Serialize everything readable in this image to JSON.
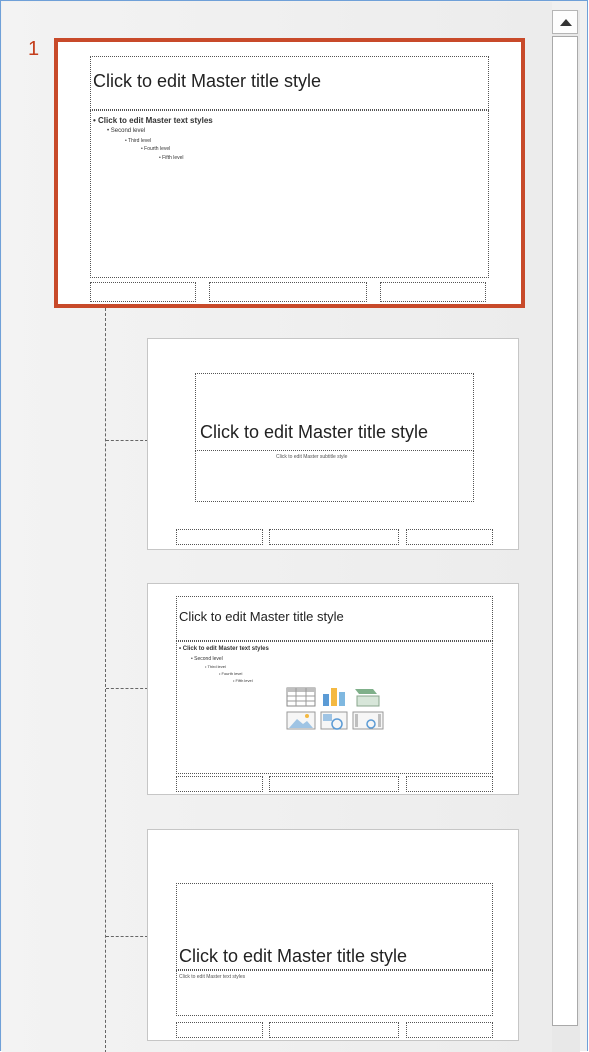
{
  "slide_panel": {
    "master": {
      "number": "1",
      "title": "Click to edit Master title style",
      "levels": [
        "• Click to edit Master text styles",
        "• Second level",
        "• Third level",
        "• Fourth level",
        "• Fifth level"
      ]
    },
    "layouts": [
      {
        "name": "title-slide-layout",
        "title": "Click to edit Master title style",
        "subtitle": "Click to edit Master subtitle style"
      },
      {
        "name": "title-and-content-layout",
        "title": "Click to edit Master title style",
        "levels": [
          "• Click to edit Master text styles",
          "• Second level",
          "• Third level",
          "• Fourth level",
          "• Fifth level"
        ],
        "content_icons": [
          "table-icon",
          "chart-icon",
          "smartart-icon",
          "picture-icon",
          "online-picture-icon",
          "video-icon"
        ]
      },
      {
        "name": "section-header-layout",
        "title": "Click to edit Master title style",
        "text": "Click to edit Master text styles"
      }
    ]
  },
  "scrollbar": {
    "up_icon": "arrow-up-icon"
  },
  "colors": {
    "selection_border": "#c84a2a",
    "slide_number": "#c43e1c",
    "frame_border": "#6fa0d8"
  }
}
